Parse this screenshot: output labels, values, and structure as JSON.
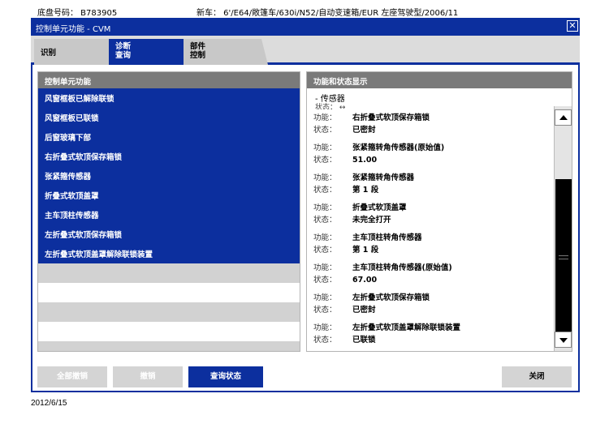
{
  "info": {
    "vin": "底盘号码： B783905",
    "model": "新车：  6'/E64/敞篷车/630i/N52/自动变速箱/EUR 左座驾驶型/2006/11"
  },
  "window": {
    "title": "控制单元功能 - CVM",
    "close_glyph": "✕"
  },
  "tabs": [
    {
      "label": "识别"
    },
    {
      "label_line1": "诊断",
      "label_line2": "查询"
    },
    {
      "label_line1": "部件",
      "label_line2": "控制"
    }
  ],
  "left_panel": {
    "header": "控制单元功能",
    "items": [
      "风窗框板已解除联锁",
      "风窗框板已联锁",
      "后窗玻璃下部",
      "右折叠式软顶保存箱锁",
      "张紧箍传感器",
      "折叠式软顶盖罩",
      "主车顶柱传感器",
      "左折叠式软顶保存箱锁",
      "左折叠式软顶盖罩解除联锁装置"
    ]
  },
  "right_panel": {
    "header": "功能和状态显示",
    "group": "- 传感器",
    "clipped_row": "状态：    ↔",
    "func_label": "功能：",
    "state_label": "状态：",
    "entries": [
      {
        "function": "右折叠式软顶保存箱锁",
        "state": "已密封"
      },
      {
        "function": "张紧箍转角传感器(原始值)",
        "state": "51.00"
      },
      {
        "function": "张紧箍转角传感器",
        "state": "第 1 段"
      },
      {
        "function": "折叠式软顶盖罩",
        "state": "未完全打开"
      },
      {
        "function": "主车顶柱转角传感器",
        "state": "第 1 段"
      },
      {
        "function": "主车顶柱转角传感器(原始值)",
        "state": "67.00"
      },
      {
        "function": "左折叠式软顶保存箱锁",
        "state": "已密封"
      },
      {
        "function": "左折叠式软顶盖罩解除联锁装置",
        "state": "已联锁"
      }
    ]
  },
  "buttons": {
    "all_cancel": "全部撤销",
    "cancel": "撤销",
    "query_status": "查询状态",
    "close": "关闭"
  },
  "footer": {
    "date": "2012/6/15"
  }
}
